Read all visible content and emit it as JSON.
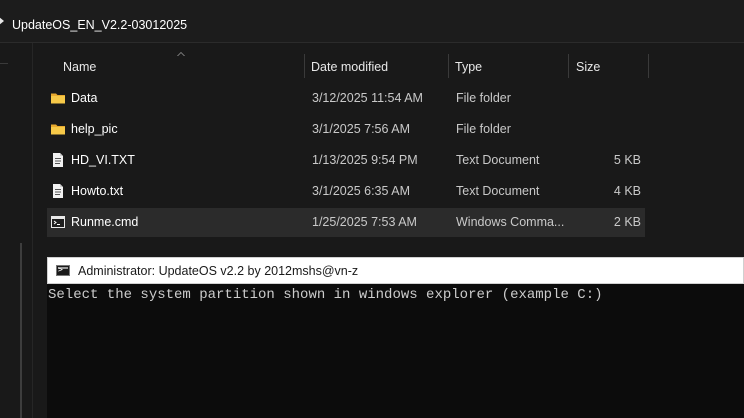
{
  "breadcrumb": {
    "current_folder": "UpdateOS_EN_V2.2-03012025"
  },
  "columns": {
    "name": "Name",
    "date_modified": "Date modified",
    "type": "Type",
    "size": "Size"
  },
  "files": [
    {
      "name": "Data",
      "date": "3/12/2025 11:54 AM",
      "type": "File folder",
      "size": "",
      "icon": "folder-icon"
    },
    {
      "name": "help_pic",
      "date": "3/1/2025 7:56 AM",
      "type": "File folder",
      "size": "",
      "icon": "folder-icon"
    },
    {
      "name": "HD_VI.TXT",
      "date": "1/13/2025 9:54 PM",
      "type": "Text Document",
      "size": "5 KB",
      "icon": "text-file-icon"
    },
    {
      "name": "Howto.txt",
      "date": "3/1/2025 6:35 AM",
      "type": "Text Document",
      "size": "4 KB",
      "icon": "text-file-icon"
    },
    {
      "name": "Runme.cmd",
      "date": "1/25/2025 7:53 AM",
      "type": "Windows Comma...",
      "size": "2 KB",
      "icon": "cmd-file-icon",
      "selected": true
    }
  ],
  "console": {
    "title": "Administrator:  UpdateOS v2.2 by 2012mshs@vn-z",
    "output": "Select the system partition shown in windows explorer (example C:)"
  },
  "colors": {
    "folder": "#f4c34a",
    "selection": "#2b2b2b",
    "console_bg": "#0c0c0c"
  }
}
